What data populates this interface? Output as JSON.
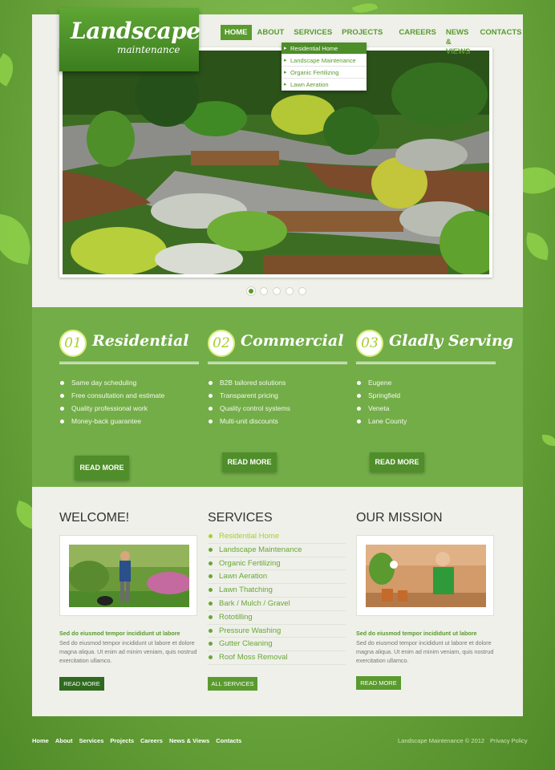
{
  "logo": {
    "line1": "Landscape",
    "line2": "maintenance"
  },
  "nav": [
    "Home",
    "About",
    "Services",
    "Projects",
    "Careers",
    "News & Views",
    "Contacts"
  ],
  "dropdown": [
    "Residential Home",
    "Landscape Maintenance",
    "Organic Fertilizing",
    "Lawn Aeration"
  ],
  "features": [
    {
      "num": "01",
      "title": "Residential",
      "items": [
        "Same day scheduling",
        "Free consultation and estimate",
        "Quality professional work",
        "Money-back guarantee"
      ],
      "button": "READ MORE"
    },
    {
      "num": "02",
      "title": "Commercial",
      "items": [
        "B2B tailored solutions",
        "Transparent pricing",
        "Quality control systems",
        "Multi-unit discounts"
      ],
      "button": "READ MORE"
    },
    {
      "num": "03",
      "title": "Gladly Serving",
      "items": [
        "Eugene",
        "Springfield",
        "Veneta",
        "Lane County"
      ],
      "button": "READ MORE"
    }
  ],
  "welcome": {
    "title": "WELCOME!",
    "lead": "Sed do eiusmod tempor incididunt ut labore",
    "body": "Sed do eiusmod tempor incididunt ut labore et dolore magna aliqua. Ut enim ad minim veniam, quis nostrud exercitation ullamco.",
    "button": "READ MORE"
  },
  "services": {
    "title": "SERVICES",
    "items": [
      "Residential Home",
      "Landscape Maintenance",
      "Organic Fertilizing",
      "Lawn Aeration",
      "Lawn Thatching",
      "Bark / Mulch / Gravel",
      "Rototilling",
      "Pressure Washing",
      "Gutter Cleaning",
      "Roof Moss Removal"
    ],
    "button": "ALL SERVICES"
  },
  "mission": {
    "title": "OUR MISSION",
    "lead": "Sed do eiusmod tempor incididunt ut labore",
    "body": "Sed do eiusmod tempor incididunt ut labore et dolore magna aliqua. Ut enim ad minim veniam, quis nostrud exercitation ullamco.",
    "button": "READ MORE"
  },
  "footer": {
    "links": [
      "Home",
      "About",
      "Services",
      "Projects",
      "Careers",
      "News & Views",
      "Contacts"
    ],
    "copyright": "Landscape Maintenance © 2012",
    "privacy": "Privacy Policy"
  },
  "colors": {
    "brand": "#5a9a2e",
    "band": "#73ad48",
    "accent": "#a9cf2e"
  }
}
